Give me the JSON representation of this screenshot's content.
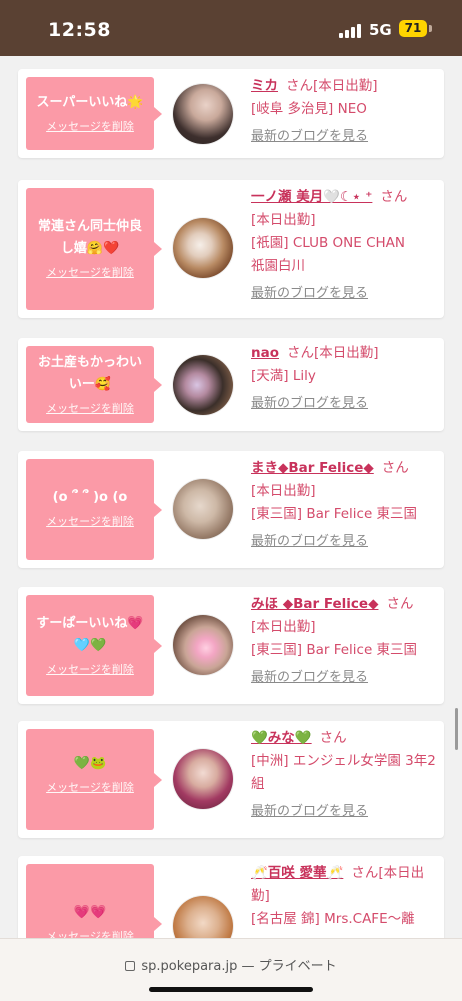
{
  "status": {
    "time": "12:58",
    "network": "5G",
    "battery": "71"
  },
  "colors": {
    "bubble": "#fb9aa7",
    "link": "#c8325b",
    "accent": "#d44b6b"
  },
  "common": {
    "delete_label": "メッセージを削除",
    "blog_label": "最新のブログを見る"
  },
  "cards": [
    {
      "message": "スーパーいいね🌟",
      "name": "ミカ",
      "san": "さん",
      "line1": "[本日出勤]",
      "line2": "[岐阜 多治見] NEO",
      "line3": ""
    },
    {
      "message": "常連さん同士仲良し嬉🤗❤️",
      "name": "一ノ瀬 美月🤍☾⋆ ⁺",
      "san": "さん",
      "line1": "[本日出勤]",
      "line2": "[祇園] CLUB ONE CHAN",
      "line3": "祇園白川"
    },
    {
      "message": "お土産もかっわいいー🥰",
      "name": "nao",
      "san": "さん",
      "line1": "[本日出勤]",
      "line2": "[天満] Lily",
      "line3": ""
    },
    {
      "message": "(o ՞ ՞ )o (o",
      "name": "まき◆Bar Felice◆",
      "san": "さん",
      "line1": "[本日出勤]",
      "line2": "[東三国] Bar Felice 東三国",
      "line3": ""
    },
    {
      "message": "すーぱーいいね💗🩵💚",
      "name": "みほ ◆Bar Felice◆",
      "san": "さん",
      "line1": "[本日出勤]",
      "line2": "[東三国] Bar Felice 東三国",
      "line3": ""
    },
    {
      "message": "💚🐸",
      "name": "💚みな💚",
      "san": "さん",
      "line1": "[中洲] エンジェル女学園 3年2組",
      "line2": "",
      "line3": ""
    },
    {
      "message": "💗💗",
      "name": "🥂百咲 愛華🥂",
      "san": "さん",
      "line1": "[本日出勤]",
      "line2": "[名古屋 錦] Mrs.CAFE～離",
      "line3": ""
    }
  ],
  "urlbar": {
    "url": "sp.pokepara.jp — プライベート"
  }
}
